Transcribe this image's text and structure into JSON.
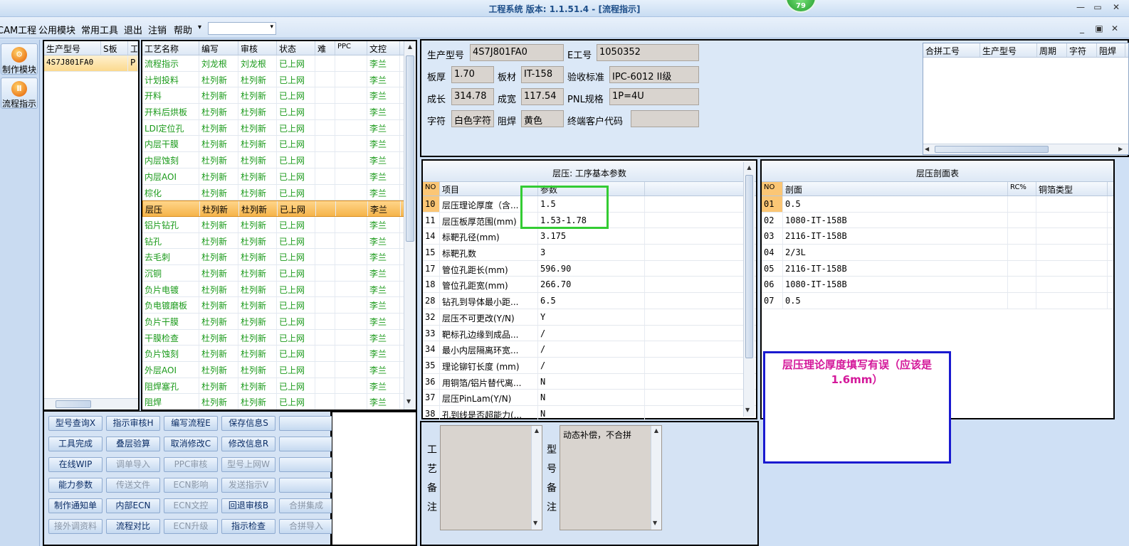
{
  "window": {
    "title": "工程系统  版本: 1.1.51.4 - [流程指示]",
    "badge": "79",
    "min": "—",
    "restore": "▭",
    "close": "✕",
    "min2": "_",
    "restore2": "▣",
    "close2": "✕"
  },
  "menu": {
    "items": [
      "CAM工程",
      "公用模块",
      "常用工具",
      "退出",
      "注销",
      "帮助"
    ],
    "dropdown_arrow": "▾",
    "combo_value": ""
  },
  "sidebar": {
    "buttons": [
      {
        "label": "制作模块",
        "icon": "gear-orange-icon"
      },
      {
        "label": "流程指示",
        "icon": "flow-orange-icon"
      }
    ]
  },
  "model_grid": {
    "headers": [
      "生产型号",
      "S板",
      "工"
    ],
    "rows": [
      [
        "4S7J801FA0",
        "P"
      ]
    ]
  },
  "process_grid": {
    "headers": [
      "工艺名称",
      "编写",
      "审核",
      "状态",
      "难",
      "PPC",
      "文控"
    ],
    "rows": [
      [
        "流程指示",
        "刘龙根",
        "刘龙根",
        "已上网",
        "",
        "",
        "李兰"
      ],
      [
        "计划投料",
        "杜列新",
        "杜列新",
        "已上网",
        "",
        "",
        "李兰"
      ],
      [
        "开料",
        "杜列新",
        "杜列新",
        "已上网",
        "",
        "",
        "李兰"
      ],
      [
        "开料后烘板",
        "杜列新",
        "杜列新",
        "已上网",
        "",
        "",
        "李兰"
      ],
      [
        "LDI定位孔",
        "杜列新",
        "杜列新",
        "已上网",
        "",
        "",
        "李兰"
      ],
      [
        "内层干膜",
        "杜列新",
        "杜列新",
        "已上网",
        "",
        "",
        "李兰"
      ],
      [
        "内层蚀刻",
        "杜列新",
        "杜列新",
        "已上网",
        "",
        "",
        "李兰"
      ],
      [
        "内层AOI",
        "杜列新",
        "杜列新",
        "已上网",
        "",
        "",
        "李兰"
      ],
      [
        "棕化",
        "杜列新",
        "杜列新",
        "已上网",
        "",
        "",
        "李兰"
      ],
      [
        "层压",
        "杜列新",
        "杜列新",
        "已上网",
        "",
        "",
        "李兰"
      ],
      [
        "铝片钻孔",
        "杜列新",
        "杜列新",
        "已上网",
        "",
        "",
        "李兰"
      ],
      [
        "钻孔",
        "杜列新",
        "杜列新",
        "已上网",
        "",
        "",
        "李兰"
      ],
      [
        "去毛刺",
        "杜列新",
        "杜列新",
        "已上网",
        "",
        "",
        "李兰"
      ],
      [
        "沉铜",
        "杜列新",
        "杜列新",
        "已上网",
        "",
        "",
        "李兰"
      ],
      [
        "负片电镀",
        "杜列新",
        "杜列新",
        "已上网",
        "",
        "",
        "李兰"
      ],
      [
        "负电镀磨板",
        "杜列新",
        "杜列新",
        "已上网",
        "",
        "",
        "李兰"
      ],
      [
        "负片干膜",
        "杜列新",
        "杜列新",
        "已上网",
        "",
        "",
        "李兰"
      ],
      [
        "干膜检查",
        "杜列新",
        "杜列新",
        "已上网",
        "",
        "",
        "李兰"
      ],
      [
        "负片蚀刻",
        "杜列新",
        "杜列新",
        "已上网",
        "",
        "",
        "李兰"
      ],
      [
        "外层AOI",
        "杜列新",
        "杜列新",
        "已上网",
        "",
        "",
        "李兰"
      ],
      [
        "阻焊塞孔",
        "杜列新",
        "杜列新",
        "已上网",
        "",
        "",
        "李兰"
      ],
      [
        "阻焊",
        "杜列新",
        "杜列新",
        "已上网",
        "",
        "",
        "李兰"
      ]
    ],
    "selected_index": 9
  },
  "toolbar_buttons": [
    {
      "label": "型号查询X",
      "disabled": false
    },
    {
      "label": "指示审核H",
      "disabled": false
    },
    {
      "label": "编写流程E",
      "disabled": false
    },
    {
      "label": "保存信息S",
      "disabled": false
    },
    {
      "label": "",
      "disabled": false
    },
    {
      "label": "工具完成",
      "disabled": false
    },
    {
      "label": "叠层验算",
      "disabled": false
    },
    {
      "label": "取消修改C",
      "disabled": false
    },
    {
      "label": "修改信息R",
      "disabled": false
    },
    {
      "label": "",
      "disabled": false
    },
    {
      "label": "在线WIP",
      "disabled": false
    },
    {
      "label": "调单导入",
      "disabled": true
    },
    {
      "label": "PPC审核",
      "disabled": true
    },
    {
      "label": "型号上网W",
      "disabled": true
    },
    {
      "label": "",
      "disabled": false
    },
    {
      "label": "能力参数",
      "disabled": false
    },
    {
      "label": "传送文件",
      "disabled": true
    },
    {
      "label": "ECN影响",
      "disabled": true
    },
    {
      "label": "发送指示V",
      "disabled": true
    },
    {
      "label": "",
      "disabled": false
    },
    {
      "label": "制作通知单",
      "disabled": false
    },
    {
      "label": "内部ECN",
      "disabled": false
    },
    {
      "label": "ECN文控",
      "disabled": true
    },
    {
      "label": "回退审核B",
      "disabled": false
    },
    {
      "label": "合拼集成",
      "disabled": true
    },
    {
      "label": "接外调资料",
      "disabled": true
    },
    {
      "label": "流程对比",
      "disabled": false
    },
    {
      "label": "ECN升级",
      "disabled": true
    },
    {
      "label": "指示检查",
      "disabled": false
    },
    {
      "label": "合拼导入",
      "disabled": true
    }
  ],
  "info": {
    "product_model_label": "生产型号",
    "product_model": "4S7J801FA0",
    "e_no_label": "E工号",
    "e_no": "1050352",
    "thickness_label": "板厚",
    "thickness": "1.70",
    "material_label": "板材",
    "material": "IT-158",
    "standard_label": "验收标准",
    "standard": "IPC-6012 II级",
    "length_label": "成长",
    "length": "314.78",
    "width_label": "成宽",
    "width": "117.54",
    "pnl_label": "PNL规格",
    "pnl": "1P=4U",
    "char_label": "字符",
    "char": "白色字符",
    "mask_label": "阻焊",
    "mask": "黄色",
    "customer_label": "终端客户代码",
    "customer": ""
  },
  "merge_grid": {
    "headers": [
      "合拼工号",
      "生产型号",
      "周期",
      "字符",
      "阻焊"
    ]
  },
  "params": {
    "title": "层压: 工序基本参数",
    "headers": [
      "NO",
      "项目",
      "参数"
    ],
    "rows": [
      [
        "10",
        "层压理论厚度（含...",
        "1.5"
      ],
      [
        "11",
        "层压板厚范围(mm)",
        "1.53-1.78"
      ],
      [
        "14",
        "标靶孔径(mm)",
        "3.175"
      ],
      [
        "15",
        "标靶孔数",
        "3"
      ],
      [
        "17",
        "管位孔距长(mm)",
        "596.90"
      ],
      [
        "18",
        "管位孔距宽(mm)",
        "266.70"
      ],
      [
        "28",
        "钻孔到导体最小距...",
        "6.5"
      ],
      [
        "32",
        "层压不可更改(Y/N)",
        "Y"
      ],
      [
        "33",
        "靶标孔边缘到成品...",
        "/"
      ],
      [
        "34",
        "最小内层隔离环宽...",
        "/"
      ],
      [
        "35",
        "理论铆钉长度 (mm)",
        "/"
      ],
      [
        "36",
        "用铜箔/铝片替代离...",
        "N"
      ],
      [
        "37",
        "层压PinLam(Y/N)",
        "N"
      ],
      [
        "38",
        "孔到线是否超能力(...",
        "N"
      ]
    ]
  },
  "profile": {
    "title": "层压剖面表",
    "headers": [
      "NO",
      "剖面",
      "RC%",
      "铜箔类型"
    ],
    "rows": [
      [
        "01",
        "0.5"
      ],
      [
        "02",
        "1080-IT-158B"
      ],
      [
        "03",
        "2116-IT-158B"
      ],
      [
        "04",
        "2/3L"
      ],
      [
        "05",
        "2116-IT-158B"
      ],
      [
        "06",
        "1080-IT-158B"
      ],
      [
        "07",
        "0.5"
      ]
    ]
  },
  "notes": {
    "process_label": "工艺备注",
    "process_note": "",
    "model_label": "型号备注",
    "model_note": "动态补偿，不合拼"
  },
  "annotation": {
    "text": "层压理论厚度填写有误（应该是1.6mm）"
  },
  "colors": {
    "green_text": "#1a9a1a",
    "selected_row": "#f5b44a",
    "annotation_text": "#d4189a",
    "annotation_border": "#1a1ad0",
    "highlight_box": "#33cc33"
  }
}
